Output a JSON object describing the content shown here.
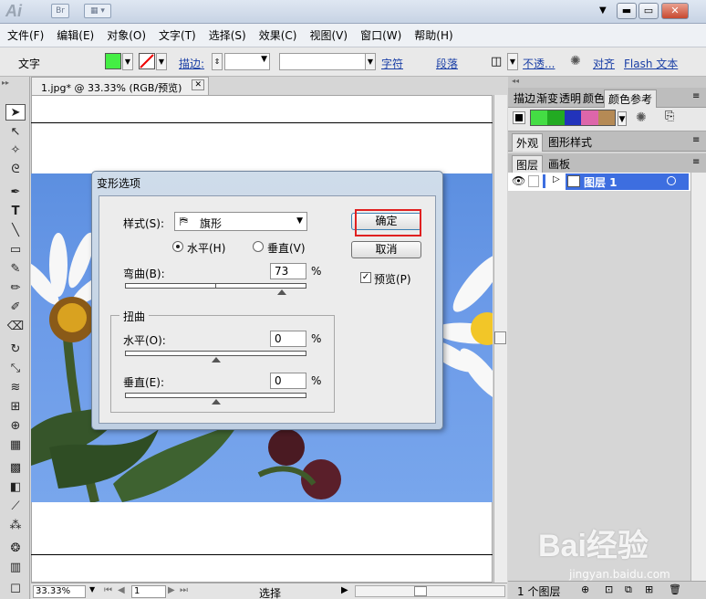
{
  "app": {
    "logo": "Ai",
    "br_label": "Br"
  },
  "menu": [
    "文件(F)",
    "编辑(E)",
    "对象(O)",
    "文字(T)",
    "选择(S)",
    "效果(C)",
    "视图(V)",
    "窗口(W)",
    "帮助(H)"
  ],
  "control": {
    "type_label": "文字",
    "fill_color": "#44ee44",
    "stroke_label": "描边:",
    "char_label": "字符",
    "para_label": "段落",
    "opacity_label": "不透...",
    "align_label": "对齐",
    "flash_label": "Flash 文本"
  },
  "document": {
    "tab_title": "1.jpg* @ 33.33% (RGB/预览)",
    "zoom": "33.33%",
    "page": "1",
    "status": "选择"
  },
  "dialog": {
    "title": "变形选项",
    "style_label": "样式(S):",
    "style_value": "旗形",
    "horizontal": "水平(H)",
    "vertical": "垂直(V)",
    "orientation": "horizontal",
    "bend_label": "弯曲(B):",
    "bend_value": "73",
    "percent": "%",
    "distortion_group": "扭曲",
    "dist_h_label": "水平(O):",
    "dist_h_value": "0",
    "dist_v_label": "垂直(E):",
    "dist_v_value": "0",
    "ok": "确定",
    "cancel": "取消",
    "preview": "预览(P)",
    "preview_checked": true,
    "bend_fraction": 0.865,
    "dist_h_fraction": 0.5,
    "dist_v_fraction": 0.5
  },
  "panels": {
    "top_tabs": [
      "描边",
      "渐变",
      "透明",
      "颜色",
      "颜色参考"
    ],
    "mid_tabs": [
      "外观",
      "图形样式"
    ],
    "layer_tabs": [
      "图层",
      "画板"
    ],
    "layer_name": "图层 1",
    "footer": "1 个图层",
    "guide_colors": [
      "#44dd44",
      "#22aa22",
      "#2233bb",
      "#dd66aa",
      "#b58a55"
    ]
  },
  "watermark": {
    "main": "Bai经验",
    "sub": "jingyan.baidu.com"
  }
}
